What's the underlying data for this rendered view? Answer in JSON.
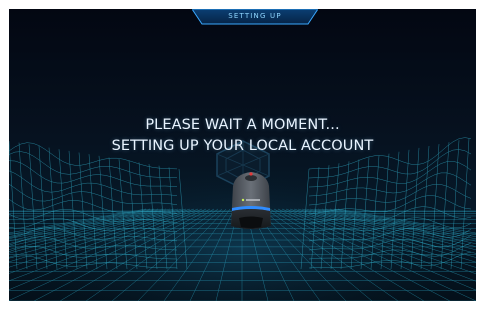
{
  "screen": {
    "title": "SETTING UP",
    "message_line_1": "PLEASE WAIT A MOMENT...",
    "message_line_2": "SETTING UP YOUR LOCAL ACCOUNT"
  },
  "icons": {
    "background": "wireframe-terrain-icon",
    "emblem": "hexagon-emblem-icon",
    "device": "hub-device-icon"
  },
  "colors": {
    "background_dark": "#030712",
    "accent_blue": "#3aa8ff",
    "grid_cyan": "#2fb6d6",
    "text": "#e9f4ff"
  }
}
